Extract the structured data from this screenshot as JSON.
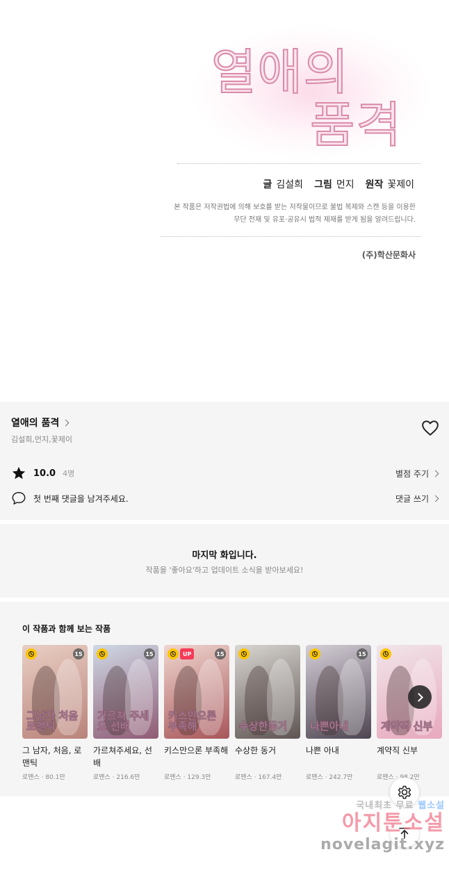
{
  "art": {
    "logo_line1": "열애의",
    "logo_line2": "품격",
    "credits": [
      {
        "key": "글",
        "value": "김설희"
      },
      {
        "key": "그림",
        "value": "먼지"
      },
      {
        "key": "원작",
        "value": "꽃제이"
      }
    ],
    "notice_line1": "본 작품은 저작권법에 의해 보호를 받는 저작물이므로 불법 복제와 스캔 등을 이용한",
    "notice_line2": "무단 전재 및 유포·공유시 법적 제재를 받게 됨을 알려드립니다.",
    "publisher": "(주)학산문화사"
  },
  "info": {
    "series_title": "열애의 품격",
    "authors": "김설희,먼지,꽃제이",
    "heart_icon": "heart-outline-icon",
    "rating_score": "10.0",
    "rating_count": "4명",
    "rate_link": "별점 주기",
    "comment_prompt": "첫 번째 댓글을 남겨주세요.",
    "comment_link": "댓글 쓰기"
  },
  "last_episode": {
    "title": "마지막 화입니다.",
    "subtitle": "작품을 '좋아요'하고 업데이트 소식을 받아보세요!"
  },
  "recommendations": {
    "section_title": "이 작품과 함께 보는 작품",
    "items": [
      {
        "title": "그 남자, 처음, 로맨틱",
        "meta": "로맨스 · 80.1만",
        "age": "15",
        "up": "",
        "cover_text": "그남자 처음 로맨틱",
        "colors": [
          "#e9cfc4",
          "#b9837a"
        ]
      },
      {
        "title": "가르쳐주세요, 선배",
        "meta": "로맨스 · 216.6만",
        "age": "15",
        "up": "",
        "cover_text": "가르쳐 주세요 선배",
        "colors": [
          "#cfd9e6",
          "#8f5b74"
        ]
      },
      {
        "title": "키스만으론 부족해",
        "meta": "로맨스 · 129.3만",
        "age": "15",
        "up": "UP",
        "cover_text": "키스만으론 부족해",
        "colors": [
          "#efd6cf",
          "#a8565a"
        ]
      },
      {
        "title": "수상한 동거",
        "meta": "로맨스 · 167.4만",
        "age": "",
        "up": "",
        "cover_text": "수상한동거",
        "colors": [
          "#d9d6d2",
          "#5e5552"
        ]
      },
      {
        "title": "나쁜 아내",
        "meta": "로맨스 · 242.7만",
        "age": "15",
        "up": "",
        "cover_text": "나쁜아내",
        "colors": [
          "#d5cfd8",
          "#4e4551"
        ]
      },
      {
        "title": "계약직 신부",
        "meta": "로맨스 · 98.2만",
        "age": "",
        "up": "",
        "cover_text": "계약직 신부",
        "colors": [
          "#f1e5ea",
          "#e7a8bd"
        ]
      }
    ]
  },
  "watermark": {
    "line1_a": "국내최초 무료",
    "line1_b": "웹소설",
    "line2": "아지툰소설",
    "line3": "novelagit.xyz"
  }
}
